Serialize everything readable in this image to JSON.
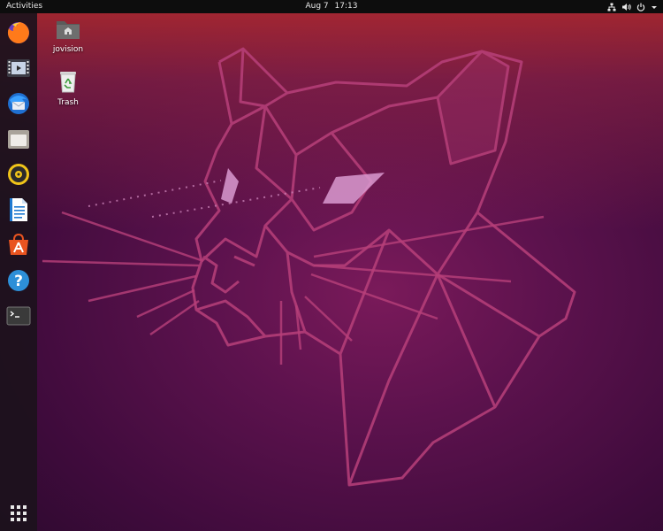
{
  "topbar": {
    "activities_label": "Activities",
    "date": "Aug 7",
    "time": "17:13",
    "tray_icons": [
      "network-icon",
      "volume-icon",
      "power-icon",
      "chevron-down-icon"
    ]
  },
  "dock": {
    "items": [
      {
        "name": "Firefox",
        "icon": "firefox-icon"
      },
      {
        "name": "Videos",
        "icon": "videos-icon"
      },
      {
        "name": "Thunderbird",
        "icon": "thunderbird-icon"
      },
      {
        "name": "Files",
        "icon": "files-icon"
      },
      {
        "name": "Rhythmbox",
        "icon": "rhythmbox-icon"
      },
      {
        "name": "LibreOffice Writer",
        "icon": "writer-icon"
      },
      {
        "name": "Ubuntu Software",
        "icon": "software-icon"
      },
      {
        "name": "Help",
        "icon": "help-icon"
      },
      {
        "name": "Terminal",
        "icon": "terminal-icon"
      }
    ],
    "show_apps_icon": "app-grid-icon"
  },
  "desktop": {
    "icons": [
      {
        "label": "jovision",
        "icon": "home-folder-icon"
      },
      {
        "label": "Trash",
        "icon": "trash-icon"
      }
    ]
  },
  "colors": {
    "topbar": "#0d0d0d",
    "dock": "#1c121c",
    "wallpaper_top": "#b52b37",
    "wallpaper_mid": "#6a1554",
    "wallpaper_bottom": "#2e0a2f",
    "firefox_orange": "#ff7a1a",
    "software_orange": "#e95420"
  }
}
